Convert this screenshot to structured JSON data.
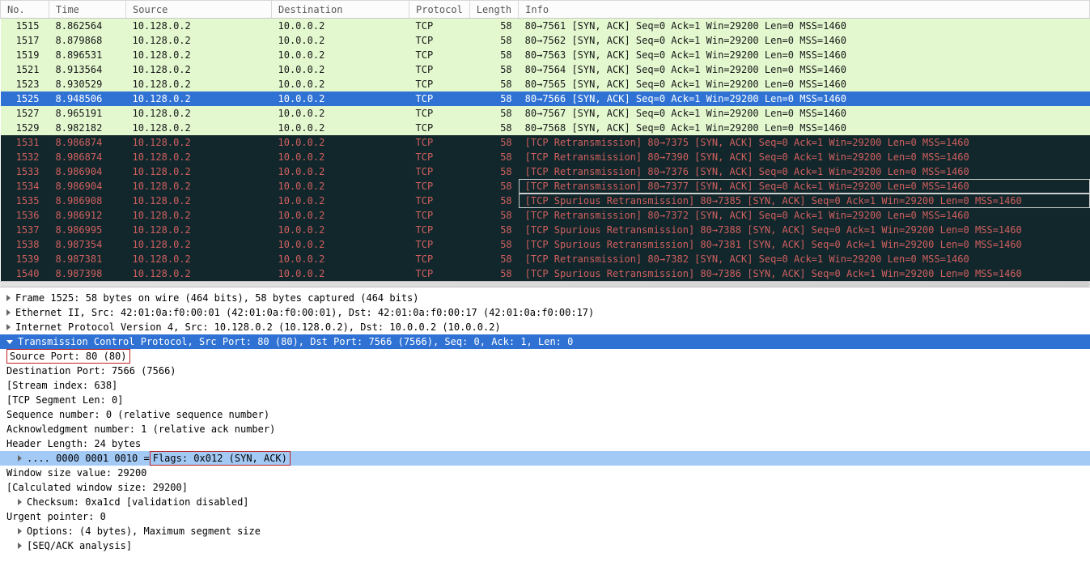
{
  "columns": {
    "no": "No.",
    "time": "Time",
    "source": "Source",
    "destination": "Destination",
    "protocol": "Protocol",
    "length": "Length",
    "info": "Info"
  },
  "packets": [
    {
      "no": "1515",
      "time": "8.862564",
      "src": "10.128.0.2",
      "dst": "10.0.0.2",
      "proto": "TCP",
      "len": "58",
      "info": "80→7561 [SYN, ACK] Seq=0 Ack=1 Win=29200 Len=0 MSS=1460",
      "style": "normal"
    },
    {
      "no": "1517",
      "time": "8.879868",
      "src": "10.128.0.2",
      "dst": "10.0.0.2",
      "proto": "TCP",
      "len": "58",
      "info": "80→7562 [SYN, ACK] Seq=0 Ack=1 Win=29200 Len=0 MSS=1460",
      "style": "normal"
    },
    {
      "no": "1519",
      "time": "8.896531",
      "src": "10.128.0.2",
      "dst": "10.0.0.2",
      "proto": "TCP",
      "len": "58",
      "info": "80→7563 [SYN, ACK] Seq=0 Ack=1 Win=29200 Len=0 MSS=1460",
      "style": "normal"
    },
    {
      "no": "1521",
      "time": "8.913564",
      "src": "10.128.0.2",
      "dst": "10.0.0.2",
      "proto": "TCP",
      "len": "58",
      "info": "80→7564 [SYN, ACK] Seq=0 Ack=1 Win=29200 Len=0 MSS=1460",
      "style": "normal"
    },
    {
      "no": "1523",
      "time": "8.930529",
      "src": "10.128.0.2",
      "dst": "10.0.0.2",
      "proto": "TCP",
      "len": "58",
      "info": "80→7565 [SYN, ACK] Seq=0 Ack=1 Win=29200 Len=0 MSS=1460",
      "style": "normal"
    },
    {
      "no": "1525",
      "time": "8.948506",
      "src": "10.128.0.2",
      "dst": "10.0.0.2",
      "proto": "TCP",
      "len": "58",
      "info": "80→7566 [SYN, ACK] Seq=0 Ack=1 Win=29200 Len=0 MSS=1460",
      "style": "selected"
    },
    {
      "no": "1527",
      "time": "8.965191",
      "src": "10.128.0.2",
      "dst": "10.0.0.2",
      "proto": "TCP",
      "len": "58",
      "info": "80→7567 [SYN, ACK] Seq=0 Ack=1 Win=29200 Len=0 MSS=1460",
      "style": "normal"
    },
    {
      "no": "1529",
      "time": "8.982182",
      "src": "10.128.0.2",
      "dst": "10.0.0.2",
      "proto": "TCP",
      "len": "58",
      "info": "80→7568 [SYN, ACK] Seq=0 Ack=1 Win=29200 Len=0 MSS=1460",
      "style": "normal"
    },
    {
      "no": "1531",
      "time": "8.986874",
      "src": "10.128.0.2",
      "dst": "10.0.0.2",
      "proto": "TCP",
      "len": "58",
      "info": "[TCP Retransmission] 80→7375 [SYN, ACK] Seq=0 Ack=1 Win=29200 Len=0 MSS=1460",
      "style": "retrans"
    },
    {
      "no": "1532",
      "time": "8.986874",
      "src": "10.128.0.2",
      "dst": "10.0.0.2",
      "proto": "TCP",
      "len": "58",
      "info": "[TCP Retransmission] 80→7390 [SYN, ACK] Seq=0 Ack=1 Win=29200 Len=0 MSS=1460",
      "style": "retrans"
    },
    {
      "no": "1533",
      "time": "8.986904",
      "src": "10.128.0.2",
      "dst": "10.0.0.2",
      "proto": "TCP",
      "len": "58",
      "info": "[TCP Retransmission] 80→7376 [SYN, ACK] Seq=0 Ack=1 Win=29200 Len=0 MSS=1460",
      "style": "retrans"
    },
    {
      "no": "1534",
      "time": "8.986904",
      "src": "10.128.0.2",
      "dst": "10.0.0.2",
      "proto": "TCP",
      "len": "58",
      "info": "[TCP Retransmission] 80→7377 [SYN, ACK] Seq=0 Ack=1 Win=29200 Len=0 MSS=1460",
      "style": "retrans",
      "boxed": true
    },
    {
      "no": "1535",
      "time": "8.986908",
      "src": "10.128.0.2",
      "dst": "10.0.0.2",
      "proto": "TCP",
      "len": "58",
      "info": "[TCP Spurious Retransmission] 80→7385 [SYN, ACK] Seq=0 Ack=1 Win=29200 Len=0 MSS=1460",
      "style": "retrans",
      "boxed": true
    },
    {
      "no": "1536",
      "time": "8.986912",
      "src": "10.128.0.2",
      "dst": "10.0.0.2",
      "proto": "TCP",
      "len": "58",
      "info": "[TCP Retransmission] 80→7372 [SYN, ACK] Seq=0 Ack=1 Win=29200 Len=0 MSS=1460",
      "style": "retrans"
    },
    {
      "no": "1537",
      "time": "8.986995",
      "src": "10.128.0.2",
      "dst": "10.0.0.2",
      "proto": "TCP",
      "len": "58",
      "info": "[TCP Spurious Retransmission] 80→7388 [SYN, ACK] Seq=0 Ack=1 Win=29200 Len=0 MSS=1460",
      "style": "retrans"
    },
    {
      "no": "1538",
      "time": "8.987354",
      "src": "10.128.0.2",
      "dst": "10.0.0.2",
      "proto": "TCP",
      "len": "58",
      "info": "[TCP Spurious Retransmission] 80→7381 [SYN, ACK] Seq=0 Ack=1 Win=29200 Len=0 MSS=1460",
      "style": "retrans"
    },
    {
      "no": "1539",
      "time": "8.987381",
      "src": "10.128.0.2",
      "dst": "10.0.0.2",
      "proto": "TCP",
      "len": "58",
      "info": "[TCP Retransmission] 80→7382 [SYN, ACK] Seq=0 Ack=1 Win=29200 Len=0 MSS=1460",
      "style": "retrans"
    },
    {
      "no": "1540",
      "time": "8.987398",
      "src": "10.128.0.2",
      "dst": "10.0.0.2",
      "proto": "TCP",
      "len": "58",
      "info": "[TCP Spurious Retransmission] 80→7386 [SYN, ACK] Seq=0 Ack=1 Win=29200 Len=0 MSS=1460",
      "style": "retrans"
    }
  ],
  "details": {
    "frame": "Frame 1525: 58 bytes on wire (464 bits), 58 bytes captured (464 bits)",
    "eth": "Ethernet II, Src: 42:01:0a:f0:00:01 (42:01:0a:f0:00:01), Dst: 42:01:0a:f0:00:17 (42:01:0a:f0:00:17)",
    "ip": "Internet Protocol Version 4, Src: 10.128.0.2 (10.128.0.2), Dst: 10.0.0.2 (10.0.0.2)",
    "tcp": "Transmission Control Protocol, Src Port: 80 (80), Dst Port: 7566 (7566), Seq: 0, Ack: 1, Len: 0",
    "srcport": "Source Port: 80 (80)",
    "dstport": "Destination Port: 7566 (7566)",
    "stream": "[Stream index: 638]",
    "seglen": "[TCP Segment Len: 0]",
    "seq": "Sequence number: 0    (relative sequence number)",
    "ack": "Acknowledgment number: 1    (relative ack number)",
    "hlen": "Header Length: 24 bytes",
    "flags_pre": ".... 0000 0001 0010 = ",
    "flags": "Flags: 0x012 (SYN, ACK)",
    "win": "Window size value: 29200",
    "calcwin": "[Calculated window size: 29200]",
    "cksum": "Checksum: 0xa1cd [validation disabled]",
    "urg": "Urgent pointer: 0",
    "opts": "Options: (4 bytes), Maximum segment size",
    "seqack": "[SEQ/ACK analysis]"
  }
}
